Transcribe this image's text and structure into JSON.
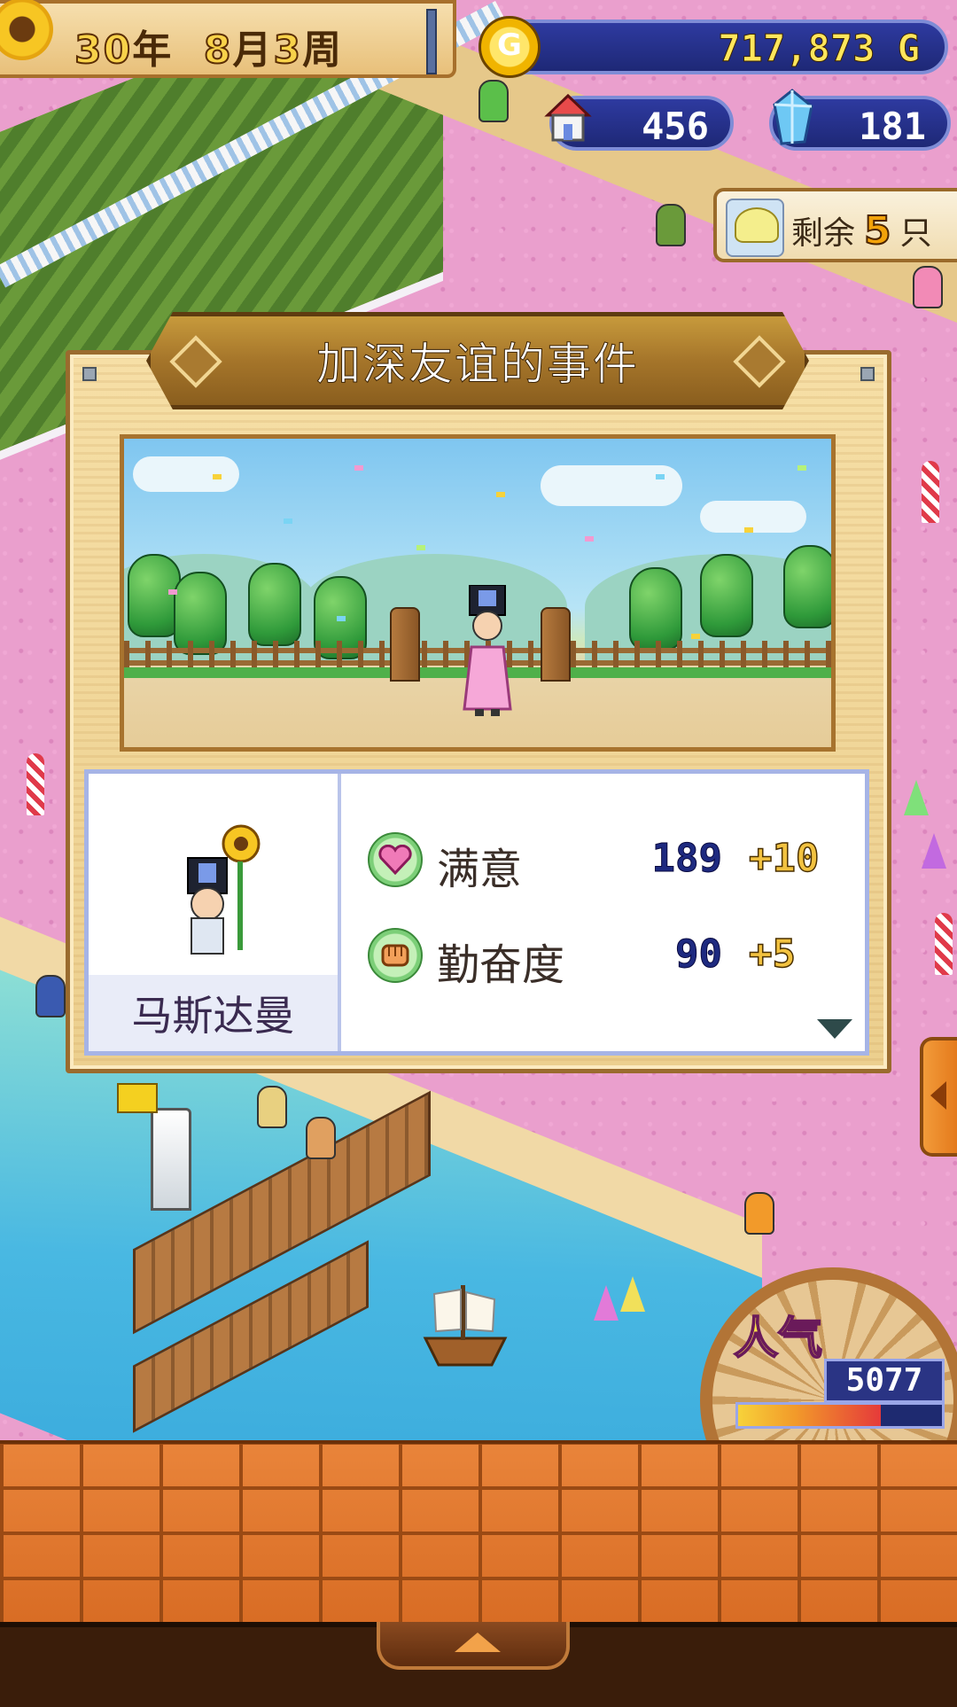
{
  "hud": {
    "date": {
      "year": "30",
      "year_unit": "年",
      "month": "8",
      "month_unit": "月",
      "week": "3",
      "week_unit": "周"
    },
    "gold": {
      "value": "717,873",
      "unit": "G",
      "coin_letter": "G"
    },
    "houses": {
      "value": "456"
    },
    "gems": {
      "value": "181"
    },
    "remaining": {
      "prefix": "剩余",
      "count": "5",
      "suffix": "只"
    }
  },
  "dialog": {
    "title": "加深友谊的事件",
    "character_name": "马斯达曼",
    "stats": [
      {
        "label": "满意",
        "value": "189",
        "delta": "+10",
        "icon": "heart-icon"
      },
      {
        "label": "勤奋度",
        "value": "90",
        "delta": "+5",
        "icon": "fist-icon"
      }
    ]
  },
  "popularity": {
    "label": "人气",
    "value": "5077",
    "level": 0.7
  },
  "colors": {
    "gold": "#ffe65c",
    "stat_value": "#1e2a80",
    "stat_delta": "#f2c240",
    "title_bar": "#a5752a"
  }
}
